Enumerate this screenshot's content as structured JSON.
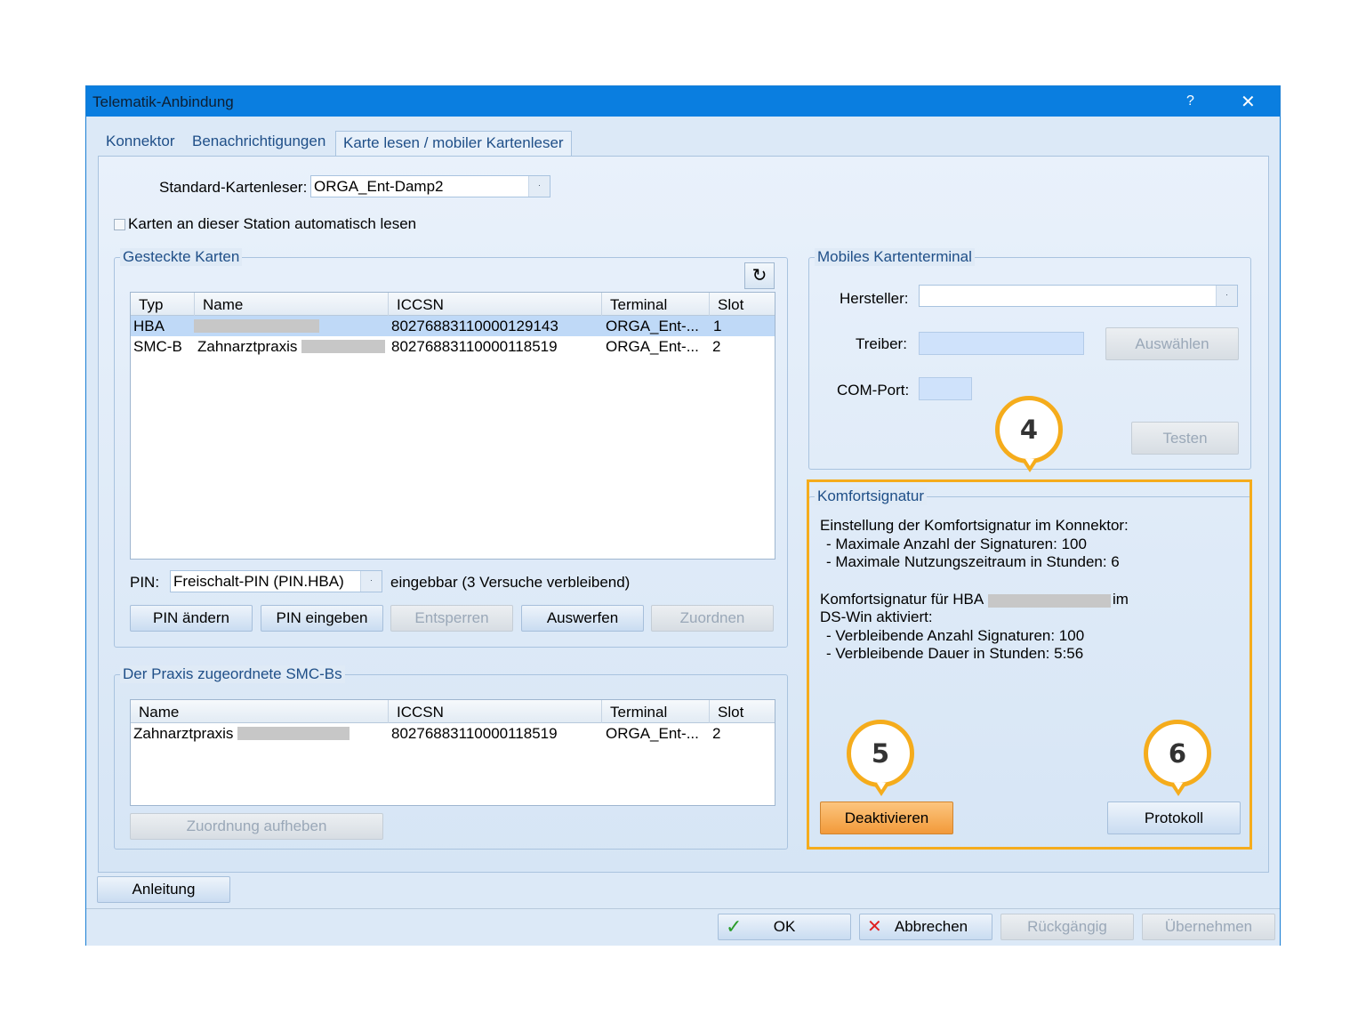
{
  "window": {
    "title": "Telematik-Anbindung",
    "help": "?",
    "close": "✕"
  },
  "tabs": [
    "Konnektor",
    "Benachrichtigungen",
    "Karte lesen / mobiler Kartenleser"
  ],
  "reader": {
    "label": "Standard-Kartenleser:",
    "value": "ORGA_Ent-Damp2",
    "dd": "·"
  },
  "auto_read": {
    "label": "Karten an dieser Station automatisch lesen",
    "checked": false
  },
  "gesteckte": {
    "legend": "Gesteckte Karten",
    "refresh_icon": "↻",
    "columns": [
      "Typ",
      "Name",
      "ICCSN",
      "Terminal",
      "Slot"
    ],
    "rows": [
      {
        "typ": "HBA",
        "name": "",
        "iccsn": "80276883110000129143",
        "terminal": "ORGA_Ent-...",
        "slot": "1"
      },
      {
        "typ": "SMC-B",
        "name": "Zahnarztpraxis",
        "iccsn": "80276883110000118519",
        "terminal": "ORGA_Ent-...",
        "slot": "2"
      }
    ],
    "pin_label": "PIN:",
    "pin_value": "Freischalt-PIN (PIN.HBA)",
    "pin_status": "eingebbar (3 Versuche verbleibend)",
    "buttons": [
      "PIN ändern",
      "PIN eingeben",
      "Entsperren",
      "Auswerfen",
      "Zuordnen"
    ]
  },
  "smcb": {
    "legend": "Der Praxis zugeordnete SMC-Bs",
    "columns": [
      "Name",
      "ICCSN",
      "Terminal",
      "Slot"
    ],
    "rows": [
      {
        "name": "Zahnarztpraxis",
        "iccsn": "80276883110000118519",
        "terminal": "ORGA_Ent-...",
        "slot": "2"
      }
    ],
    "button": "Zuordnung aufheben"
  },
  "mobil": {
    "legend": "Mobiles Kartenterminal",
    "hersteller_label": "Hersteller:",
    "treiber_label": "Treiber:",
    "com_label": "COM-Port:",
    "auswaehlen": "Auswählen",
    "testen": "Testen"
  },
  "komfort": {
    "legend": "Komfortsignatur",
    "line1": "Einstellung der Komfortsignatur im Konnektor:",
    "line2": "- Maximale Anzahl der Signaturen: 100",
    "line3": "- Maximale Nutzungszeitraum in Stunden: 6",
    "line4a": "Komfortsignatur für HBA",
    "line4b": "im",
    "line5": "DS-Win aktiviert:",
    "line6": "- Verbleibende Anzahl Signaturen: 100",
    "line7": "- Verbleibende Dauer in Stunden: 5:56",
    "deaktivieren": "Deaktivieren",
    "protokoll": "Protokoll"
  },
  "callouts": [
    "4",
    "5",
    "6"
  ],
  "footer": {
    "anleitung": "Anleitung",
    "ok": "OK",
    "abbrechen": "Abbrechen",
    "rueckgaengig": "Rückgängig",
    "uebernehmen": "Übernehmen",
    "ok_icon": "✓",
    "cancel_icon": "✕"
  },
  "colors": {
    "accent": "#0a7ee0",
    "highlight": "#f5ac1c",
    "orange_button": "#f29a3a"
  }
}
